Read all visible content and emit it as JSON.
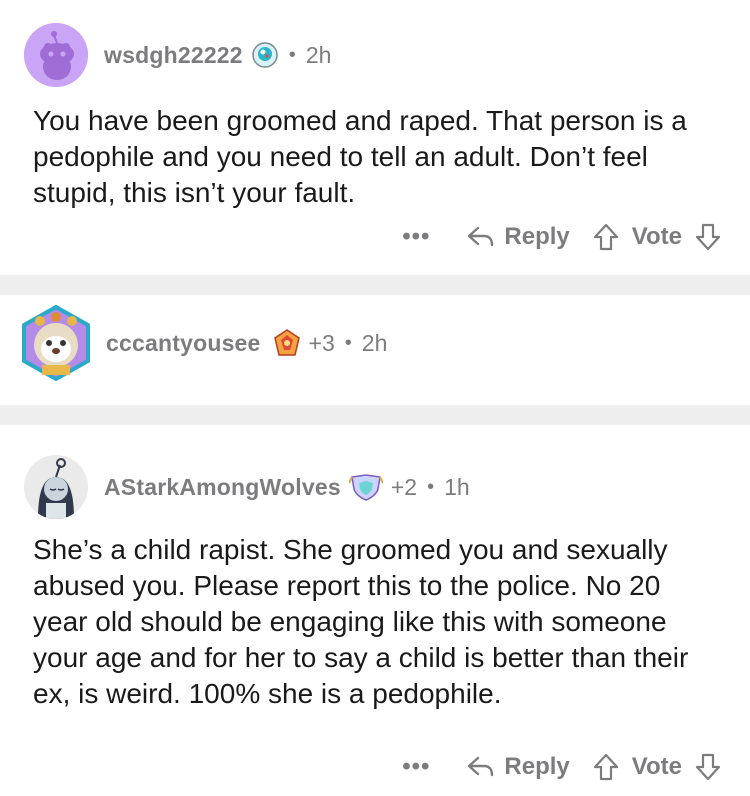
{
  "comments": [
    {
      "username": "wsdgh22222",
      "karma": "",
      "time": "2h",
      "text": "You have been groomed and raped. That person is a pedophile and you need to tell an adult. Don’t feel stupid, this isn’t your fault."
    },
    {
      "username": "cccantyousee",
      "karma": "+3",
      "time": "2h",
      "text": ""
    },
    {
      "username": "AStarkAmongWolves",
      "karma": "+2",
      "time": "1h",
      "text": "She’s a child rapist. She groomed you and sexually abused you. Please report this to the police. No 20 year old should be engaging like this with someone your age and for her to say a child is better than their ex, is weird. 100% she is a pedophile."
    }
  ],
  "actions": {
    "more": "•••",
    "reply": "Reply",
    "vote": "Vote"
  },
  "separator": "•",
  "colors": {
    "divider": "#eeeeef",
    "meta_text": "#7c7c7e",
    "body_text": "#1a1a1b",
    "avatar1_bg": "#c9a4f7"
  }
}
